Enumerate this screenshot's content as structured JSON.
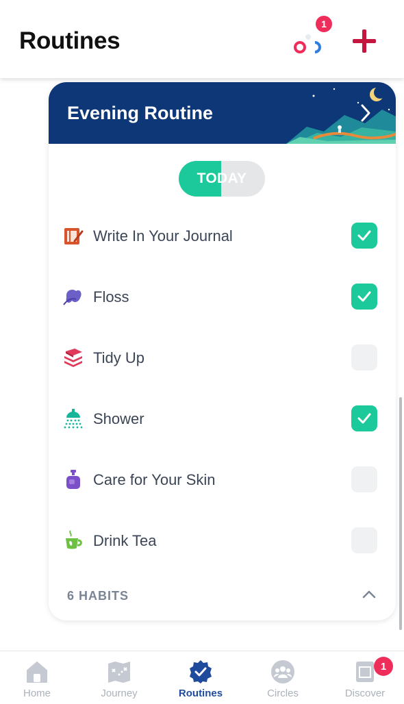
{
  "header": {
    "title": "Routines",
    "circles_notification_count": "1",
    "add_icon": "plus-icon"
  },
  "routine": {
    "title": "Evening Routine",
    "toggle_label": "TODAY",
    "habits": [
      {
        "label": "Write In Your Journal",
        "icon": "journal-icon",
        "checked": true
      },
      {
        "label": "Floss",
        "icon": "floss-icon",
        "checked": true
      },
      {
        "label": "Tidy Up",
        "icon": "tidy-up-icon",
        "checked": false
      },
      {
        "label": "Shower",
        "icon": "shower-icon",
        "checked": true
      },
      {
        "label": "Care for Your Skin",
        "icon": "skincare-icon",
        "checked": false
      },
      {
        "label": "Drink Tea",
        "icon": "tea-icon",
        "checked": false
      }
    ],
    "habits_count_label": "6 HABITS"
  },
  "nav": {
    "items": [
      {
        "label": "Home",
        "icon": "home-icon",
        "active": false
      },
      {
        "label": "Journey",
        "icon": "map-icon",
        "active": false
      },
      {
        "label": "Routines",
        "icon": "check-badge-icon",
        "active": true
      },
      {
        "label": "Circles",
        "icon": "group-icon",
        "active": false
      },
      {
        "label": "Discover",
        "icon": "discover-icon",
        "active": false
      }
    ],
    "discover_badge": "1"
  },
  "colors": {
    "accent_green": "#1bc99a",
    "banner_navy": "#0d3776",
    "badge_red": "#ee2d5a",
    "nav_active": "#1f4b9c"
  }
}
